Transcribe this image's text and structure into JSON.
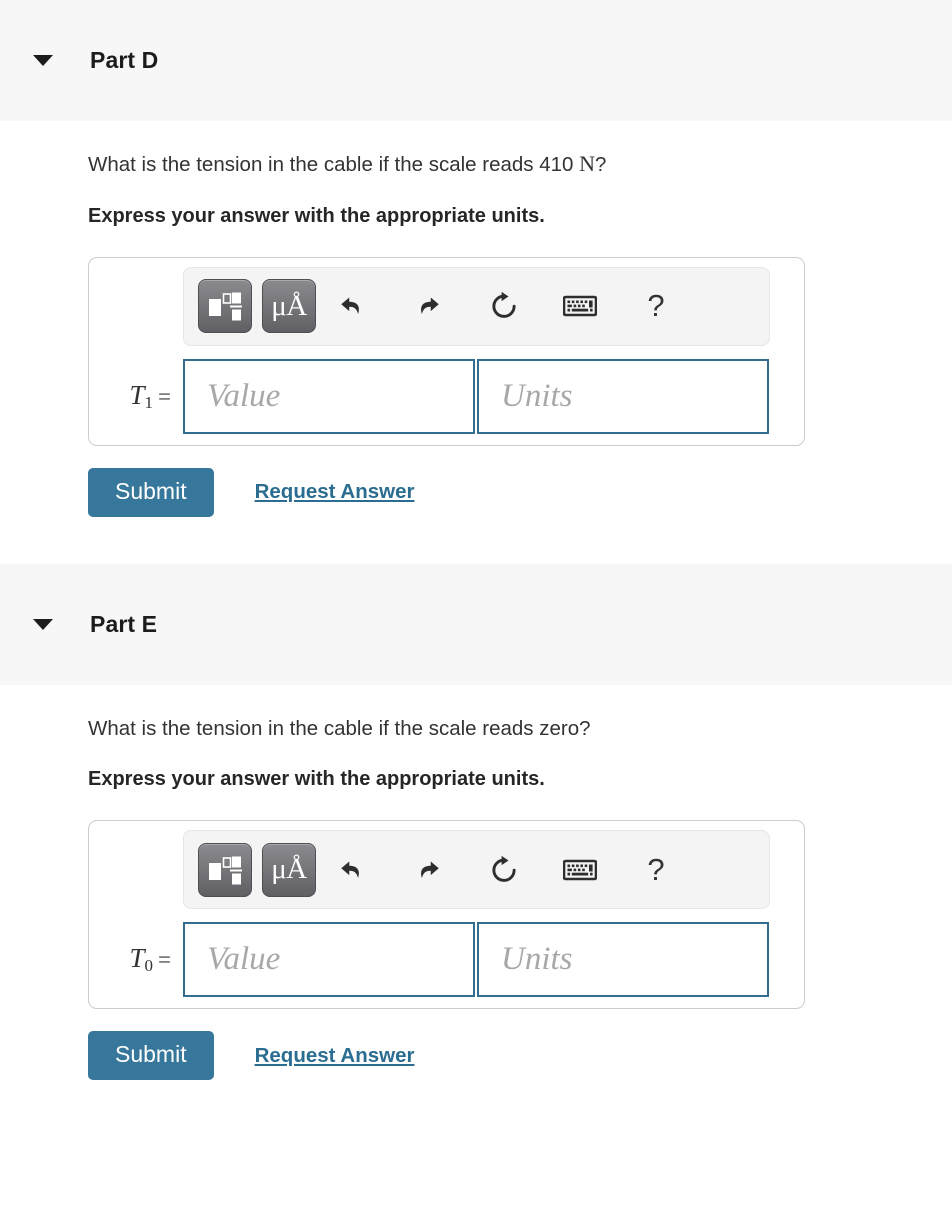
{
  "parts": [
    {
      "id": "part-d",
      "title": "Part D",
      "question_prefix": "What is the tension in the cable if the scale reads 410 ",
      "question_unit": "N",
      "question_suffix": "?",
      "instruction": "Express your answer with the appropriate units.",
      "variable_symbol": "T",
      "variable_subscript": "1",
      "equals": "=",
      "value_placeholder": "Value",
      "units_placeholder": "Units",
      "submit_label": "Submit",
      "request_label": "Request Answer"
    },
    {
      "id": "part-e",
      "title": "Part E",
      "question_prefix": "What is the tension in the cable if the scale reads zero?",
      "question_unit": "",
      "question_suffix": "",
      "instruction": "Express your answer with the appropriate units.",
      "variable_symbol": "T",
      "variable_subscript": "0",
      "equals": "=",
      "value_placeholder": "Value",
      "units_placeholder": "Units",
      "submit_label": "Submit",
      "request_label": "Request Answer"
    }
  ],
  "toolbar": {
    "template_button": "math-template-icon",
    "units_button_label": "μÅ",
    "undo_icon": "undo-icon",
    "redo_icon": "redo-icon",
    "reset_icon": "reset-icon",
    "keyboard_icon": "keyboard-icon",
    "help_label": "?"
  },
  "colors": {
    "accent": "#36779b",
    "link": "#2b6d91",
    "field_border": "#336e8e",
    "header_bg": "#f7f7f7",
    "toolbar_bg": "#f4f4f4"
  }
}
